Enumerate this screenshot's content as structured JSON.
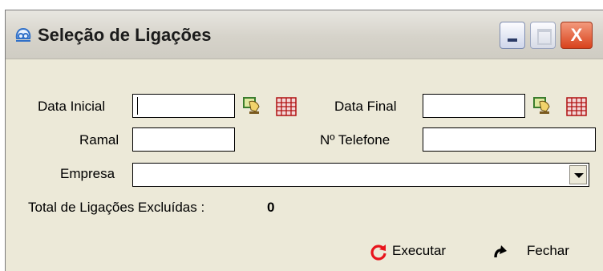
{
  "window": {
    "title": "Seleção de Ligações",
    "icon": "app-logo-icon",
    "controls": {
      "minimize": "minimize-icon",
      "maximize": "maximize-icon",
      "close": "close-icon",
      "close_glyph": "X"
    }
  },
  "form": {
    "data_inicial": {
      "label": "Data Inicial",
      "value": "",
      "lookup_icon": "lookup-hand-icon",
      "calendar_icon": "calendar-icon"
    },
    "data_final": {
      "label": "Data Final",
      "value": "",
      "lookup_icon": "lookup-hand-icon",
      "calendar_icon": "calendar-icon"
    },
    "ramal": {
      "label": "Ramal",
      "value": ""
    },
    "telefone": {
      "label": "Nº Telefone",
      "value": ""
    },
    "empresa": {
      "label": "Empresa",
      "value": ""
    },
    "total": {
      "label": "Total de Ligações Excluídas :",
      "value": "0"
    }
  },
  "actions": {
    "executar": {
      "label": "Executar",
      "icon": "refresh-icon"
    },
    "fechar": {
      "label": "Fechar",
      "icon": "undo-arrow-icon"
    }
  },
  "colors": {
    "accent_red": "#e8141c",
    "titlebar": "#d6d3ca",
    "close_button": "#d8421c"
  }
}
